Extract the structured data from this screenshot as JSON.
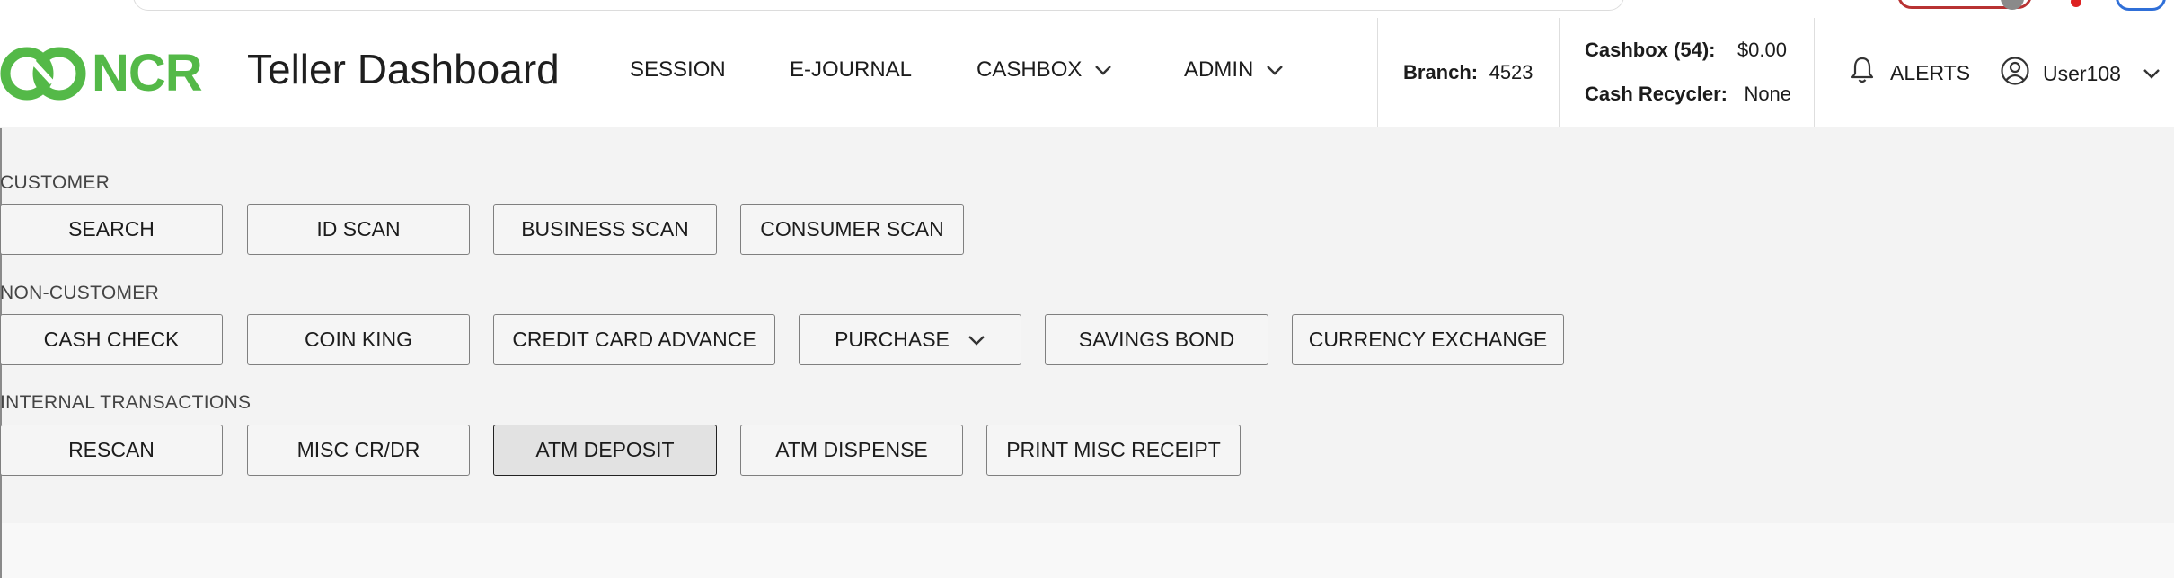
{
  "header": {
    "logo_text": "NCR",
    "title": "Teller Dashboard",
    "nav": [
      {
        "label": "SESSION",
        "icon": ""
      },
      {
        "label": "E-JOURNAL",
        "icon": ""
      },
      {
        "label": "CASHBOX",
        "icon": "chevron-down-icon"
      },
      {
        "label": "ADMIN",
        "icon": "chevron-down-icon"
      }
    ],
    "branch": {
      "label": "Branch:",
      "value": "4523"
    },
    "cashbox": {
      "label": "Cashbox (54):",
      "value": "$0.00"
    },
    "cash_recycler": {
      "label": "Cash Recycler:",
      "value": "None"
    },
    "alerts_label": "ALERTS",
    "user_label": "User108"
  },
  "sections": {
    "customer": {
      "title": "CUSTOMER",
      "buttons": [
        "SEARCH",
        "ID SCAN",
        "BUSINESS SCAN",
        "CONSUMER SCAN"
      ]
    },
    "non_customer": {
      "title": "NON-CUSTOMER",
      "buttons": [
        "CASH CHECK",
        "COIN KING",
        "CREDIT CARD ADVANCE",
        "PURCHASE",
        "SAVINGS BOND",
        "CURRENCY EXCHANGE"
      ]
    },
    "internal": {
      "title": "INTERNAL TRANSACTIONS",
      "buttons": [
        "RESCAN",
        "MISC CR/DR",
        "ATM DEPOSIT",
        "ATM DISPENSE",
        "PRINT MISC RECEIPT"
      ]
    }
  },
  "colors": {
    "brand": "#54b948",
    "background": "#f3f3f3",
    "active_button": "#e2e2e2"
  }
}
